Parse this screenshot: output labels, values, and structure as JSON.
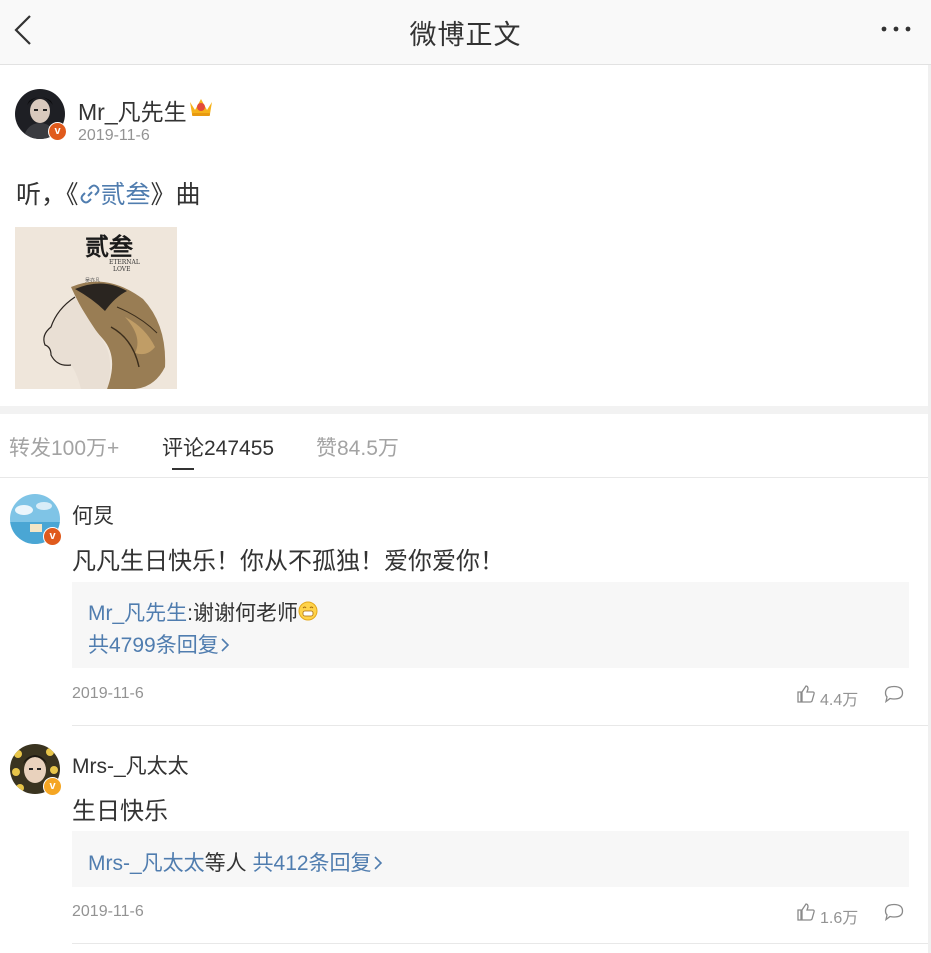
{
  "header": {
    "title": "微博正文"
  },
  "post": {
    "author": "Mr_凡先生",
    "time": "2019-11-6",
    "text_prefix": "听，《",
    "link_text": "贰叁",
    "text_suffix": "》曲",
    "image_title": "贰叁",
    "image_subtitle_1": "ETERNAL",
    "image_subtitle_2": "LOVE",
    "image_artist": "吴亦凡"
  },
  "tabs": [
    {
      "label": "转发100万+"
    },
    {
      "label": "评论247455"
    },
    {
      "label": "赞84.5万"
    }
  ],
  "comments": [
    {
      "name": "何炅",
      "text": "凡凡生日快乐！你从不孤独！爱你爱你！",
      "reply_author": "Mr_凡先生",
      "reply_text": ":谢谢何老师",
      "reply_more": "共4799条回复",
      "time": "2019-11-6",
      "likes": "4.4万"
    },
    {
      "name": "Mrs-_凡太太",
      "text": "生日快乐",
      "reply_author": "Mrs-_凡太太",
      "reply_mid": "等人",
      "reply_more": "共412条回复",
      "time": "2019-11-6",
      "likes": "1.6万"
    }
  ],
  "badge_letter": "v",
  "colors": {
    "link_blue": "#507daf",
    "verified_red": "#e05a1c",
    "verified_yellow": "#f5a623"
  }
}
